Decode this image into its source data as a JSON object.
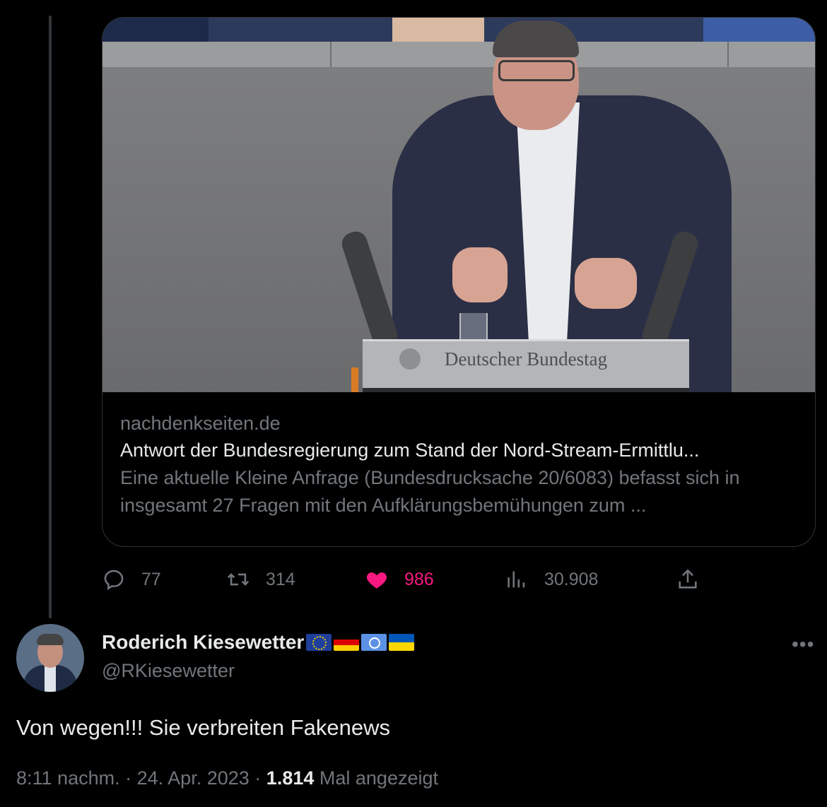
{
  "card": {
    "domain": "nachdenkseiten.de",
    "title": "Antwort der Bundesregierung zum Stand der Nord-Stream-Ermittlu...",
    "description": "Eine aktuelle Kleine Anfrage (Bundesdrucksache 20/6083) befasst sich in insgesamt 27 Fragen mit den Aufklärungsbemühungen zum ...",
    "media": {
      "podium_label": "Deutscher Bundestag"
    }
  },
  "actions": {
    "replies": "77",
    "reposts": "314",
    "likes": "986",
    "views": "30.908",
    "like_color": "#f91880"
  },
  "tweet": {
    "author_name": "Roderich Kiesewetter",
    "handle": "@RKiesewetter",
    "flags": [
      "eu-flag",
      "germany-flag",
      "un-flag",
      "ukraine-flag"
    ],
    "text": "Von wegen!!! Sie verbreiten Fakenews",
    "time": "8:11 nachm.",
    "separator": "·",
    "date": "24. Apr. 2023",
    "views_count": "1.814",
    "views_label": "Mal angezeigt",
    "more_label": "•••"
  }
}
